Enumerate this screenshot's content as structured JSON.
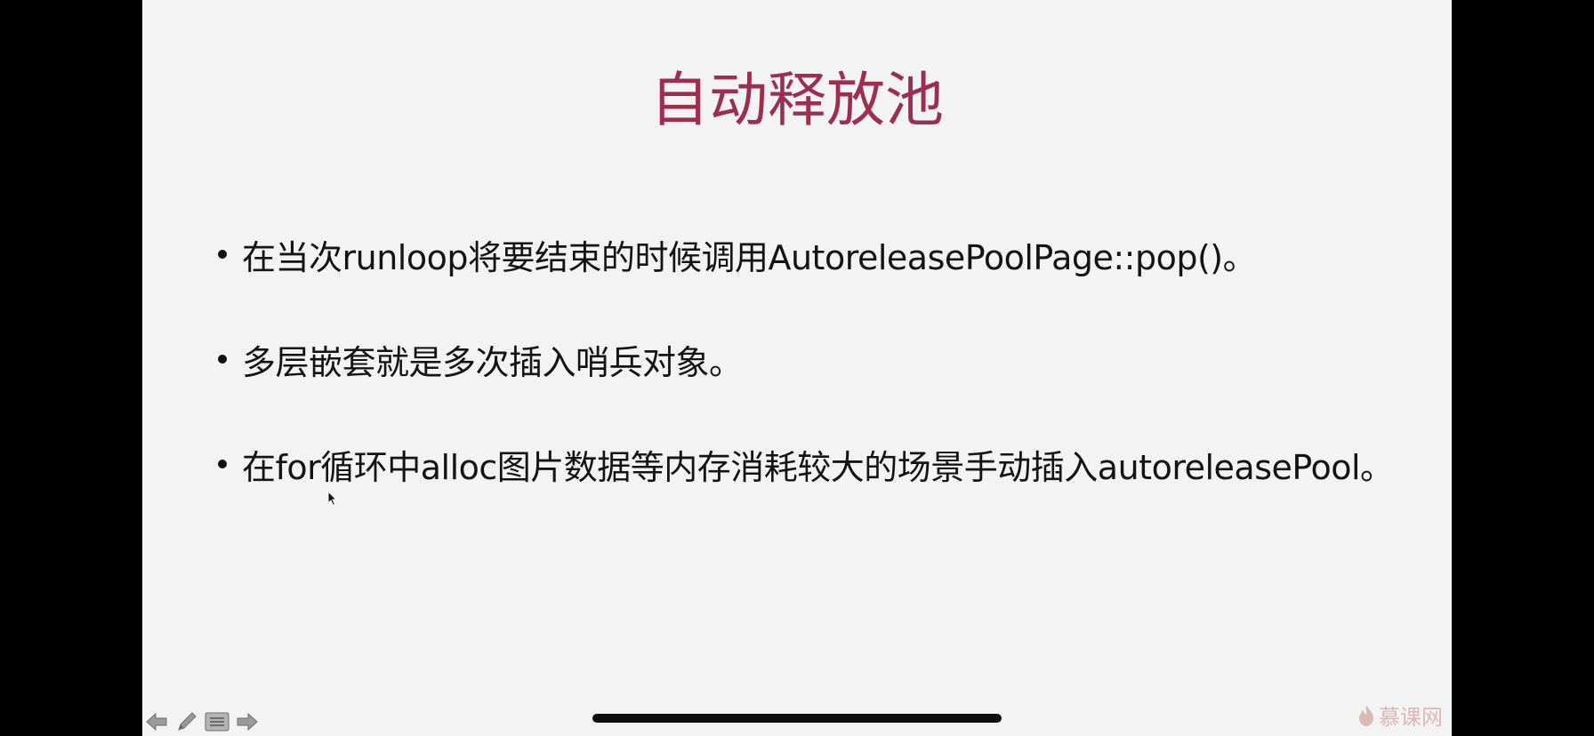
{
  "slide": {
    "title": "自动释放池",
    "bullets": [
      {
        "text": "在当次runloop将要结束的时候调用AutoreleasePoolPage::pop()。"
      },
      {
        "text": "多层嵌套就是多次插入哨兵对象。"
      },
      {
        "text": "在for循环中alloc图片数据等内存消耗较大的场景手动插入autoreleasePool。"
      }
    ],
    "title_color": "#9c2f4f"
  },
  "controls": {
    "icons": [
      "arrow-left-icon",
      "pencil-icon",
      "menu-icon",
      "arrow-right-icon"
    ]
  },
  "watermark": {
    "text": "慕课网",
    "icon": "flame-icon",
    "color": "#c98a80"
  }
}
